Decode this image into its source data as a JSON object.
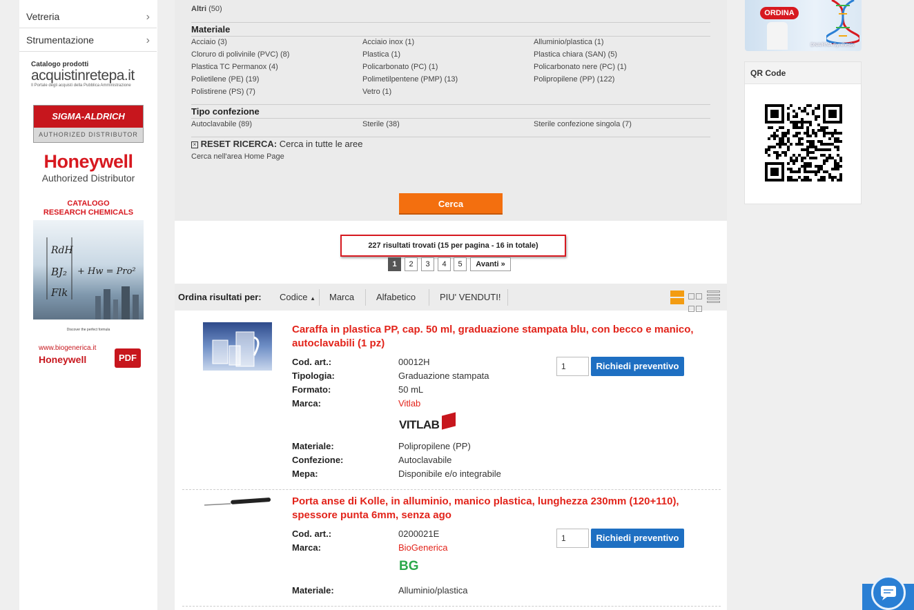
{
  "sidebar": {
    "items": [
      {
        "label": "Vetreria"
      },
      {
        "label": "Strumentazione"
      }
    ],
    "ads": {
      "acquistinrete": {
        "caption": "Catalogo prodotti",
        "logo": "acquistinretepa.it",
        "sub": "Il Portale degli acquisti della Pubblica Amministrazione"
      },
      "sigma": {
        "logo": "SIGMA-ALDRICH",
        "sub": "AUTHORIZED DISTRIBUTOR"
      },
      "honeywell": {
        "logo": "Honeywell",
        "sub": "Authorized Distributor"
      },
      "catalogo": {
        "line1": "CATALOGO",
        "line2": "RESEARCH CHEMICALS",
        "tagline": "Discover the perfect formula"
      },
      "biogenerica": {
        "url": "www.biogenerica.it",
        "brand": "Honeywell",
        "pdf": "PDF"
      }
    }
  },
  "filters": {
    "altri": {
      "label": "Altri",
      "count": "(50)"
    },
    "materiale": {
      "title": "Materiale",
      "items": [
        "Acciaio (3)",
        "Acciaio inox (1)",
        "Alluminio/plastica (1)",
        "Cloruro di polivinile (PVC) (8)",
        "Plastica (1)",
        "Plastica chiara (SAN) (5)",
        "Plastica TC Permanox (4)",
        "Policarbonato (PC) (1)",
        "Policarbonato nere (PC) (1)",
        "Polietilene (PE) (19)",
        "Polimetilpentene (PMP) (13)",
        "Polipropilene (PP) (122)",
        "Polistirene (PS) (7)",
        "Vetro (1)"
      ]
    },
    "tipo": {
      "title": "Tipo confezione",
      "items": [
        "Autoclavabile (89)",
        "Sterile (38)",
        "Sterile confezione singola (7)"
      ]
    },
    "reset": {
      "bold": "RESET RICERCA:",
      "text": "Cerca in tutte le aree",
      "sub": "Cerca nell'area Home Page"
    },
    "search_button": "Cerca"
  },
  "results": {
    "summary": "227 risultati trovati (15 per pagina - 16 in totale)",
    "pages": [
      "1",
      "2",
      "3",
      "4",
      "5"
    ],
    "next": "Avanti »",
    "sort_label": "Ordina risultati per:",
    "sort_options": [
      "Codice",
      "Marca",
      "Alfabetico",
      "PIU' VENDUTI!"
    ]
  },
  "products": [
    {
      "title": "Caraffa in plastica PP, cap. 50 ml, graduazione stampata blu, con becco e manico, autoclavabili (1 pz)",
      "fields": [
        {
          "label": "Cod. art.:",
          "value": "00012H"
        },
        {
          "label": "Tipologia:",
          "value": "Graduazione stampata"
        },
        {
          "label": "Formato:",
          "value": "50 mL"
        },
        {
          "label": "Marca:",
          "value": "Vitlab"
        }
      ],
      "brand_logo": "VITLAB",
      "fields2": [
        {
          "label": "Materiale:",
          "value": "Polipropilene (PP)"
        },
        {
          "label": "Confezione:",
          "value": "Autoclavabile"
        },
        {
          "label": "Mepa:",
          "value": "Disponibile e/o integrabile"
        }
      ],
      "qty": "1",
      "button": "Richiedi preventivo"
    },
    {
      "title": "Porta anse di Kolle, in alluminio, manico plastica, lunghezza 230mm (120+110), spessore punta 6mm, senza ago",
      "fields": [
        {
          "label": "Cod. art.:",
          "value": "0200021E"
        },
        {
          "label": "Marca:",
          "value": "BioGenerica"
        }
      ],
      "brand_logo": "BG",
      "fields2": [
        {
          "label": "Materiale:",
          "value": "Alluminio/plastica"
        }
      ],
      "qty": "1",
      "button": "Richiedi preventivo"
    }
  ],
  "right": {
    "banner_button": "ORDINA",
    "banner_caption": "DNA/RNA Synthesis",
    "qr_title": "QR Code"
  },
  "colors": {
    "accent": "#e2231a",
    "button_orange": "#f36f0f",
    "button_blue": "#1e6fc2",
    "chat": "#2a7fd4"
  }
}
